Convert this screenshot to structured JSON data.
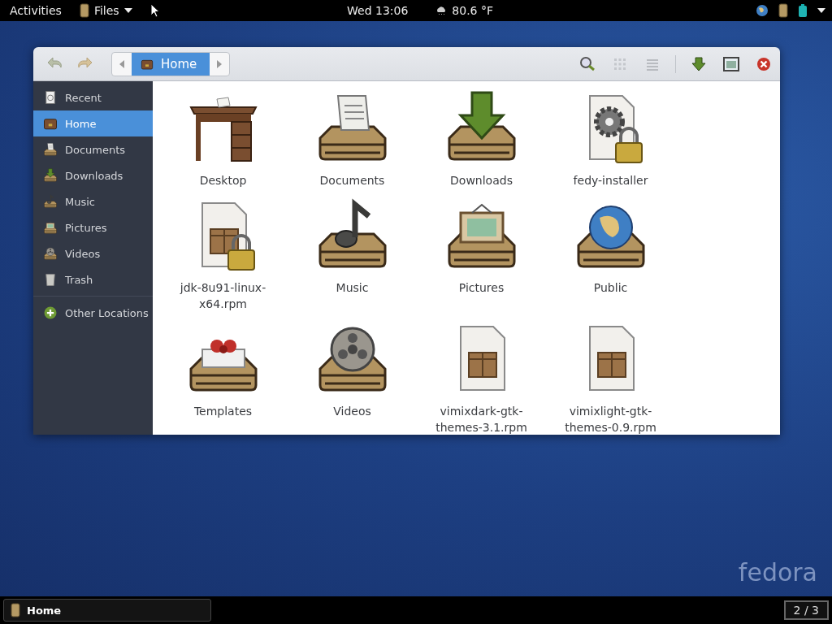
{
  "top_bar": {
    "activities": "Activities",
    "app_menu": "Files",
    "clock": "Wed 13:06",
    "weather": "80.6 °F"
  },
  "window": {
    "path": [
      {
        "label": "Home",
        "selected": true
      }
    ],
    "sidebar": [
      {
        "label": "Recent",
        "kind": "recent",
        "selected": false
      },
      {
        "label": "Home",
        "kind": "home",
        "selected": true
      },
      {
        "label": "Documents",
        "kind": "documents",
        "selected": false
      },
      {
        "label": "Downloads",
        "kind": "downloads",
        "selected": false
      },
      {
        "label": "Music",
        "kind": "music",
        "selected": false
      },
      {
        "label": "Pictures",
        "kind": "pictures",
        "selected": false
      },
      {
        "label": "Videos",
        "kind": "videos",
        "selected": false
      },
      {
        "label": "Trash",
        "kind": "trash",
        "selected": false
      },
      {
        "label": "Other Locations",
        "kind": "other",
        "selected": false
      }
    ],
    "files": [
      {
        "name": "Desktop",
        "kind": "desk"
      },
      {
        "name": "Documents",
        "kind": "documents"
      },
      {
        "name": "Downloads",
        "kind": "downloads"
      },
      {
        "name": "fedy-installer",
        "kind": "gear-locked"
      },
      {
        "name": "jdk-8u91-linux-x64.rpm",
        "kind": "package-locked"
      },
      {
        "name": "Music",
        "kind": "music"
      },
      {
        "name": "Pictures",
        "kind": "pictures"
      },
      {
        "name": "Public",
        "kind": "globe"
      },
      {
        "name": "Templates",
        "kind": "gift"
      },
      {
        "name": "Videos",
        "kind": "videos"
      },
      {
        "name": "vimixdark-gtk-themes-3.1.rpm",
        "kind": "package"
      },
      {
        "name": "vimixlight-gtk-themes-0.9.rpm",
        "kind": "package"
      }
    ]
  },
  "taskbar": {
    "task": "Home",
    "workspace": "2 / 3"
  },
  "wallpaper": {
    "logo": "fedora"
  }
}
